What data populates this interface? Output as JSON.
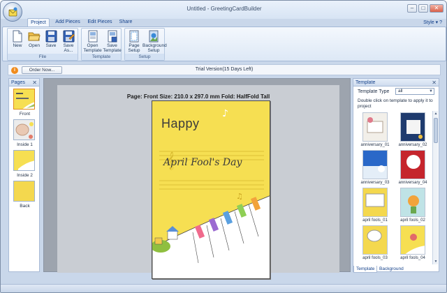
{
  "window": {
    "title": "Untitled - GreetingCardBuilder",
    "buttons": {
      "minimize": "–",
      "maximize": "□",
      "close": "✕"
    }
  },
  "tabs": [
    "Project",
    "Add Pieces",
    "Edit Pieces",
    "Share"
  ],
  "active_tab": "Project",
  "style_menu": "Style ▾ ?",
  "ribbon": {
    "groups": [
      {
        "label": "File",
        "buttons": [
          {
            "label": "New",
            "icon": "new-document-icon"
          },
          {
            "label": "Open",
            "icon": "open-folder-icon"
          },
          {
            "label": "Save",
            "icon": "save-disk-icon"
          },
          {
            "label": "Save As...",
            "icon": "save-as-disk-icon"
          }
        ]
      },
      {
        "label": "Template",
        "buttons": [
          {
            "label": "Open Template",
            "icon": "open-template-icon"
          },
          {
            "label": "Save Template",
            "icon": "save-template-icon"
          }
        ]
      },
      {
        "label": "Setup",
        "buttons": [
          {
            "label": "Page Setup",
            "icon": "page-setup-icon"
          },
          {
            "label": "Background Setup",
            "icon": "background-setup-icon"
          }
        ]
      }
    ]
  },
  "message_bar": {
    "icon": "info-icon",
    "order_button": "Order Now...",
    "trial_text": "Trial Version(15 Days Left)"
  },
  "pages_panel": {
    "title": "Pages",
    "close": "✕",
    "pages": [
      "Front",
      "Inside 1",
      "Inside 2",
      "Back"
    ]
  },
  "canvas": {
    "page_info": "Page: Front   Size: 210.0 x 297.0 mm   Fold: HalfFold Tall",
    "card": {
      "heading": "Happy",
      "subheading": "April Fool's Day"
    }
  },
  "template_panel": {
    "title": "Template",
    "close": "✕",
    "type_label": "Template Type",
    "type_value": "all",
    "hint": "Double click on template to apply it to project",
    "templates": [
      "anniversary_01",
      "anniversary_02",
      "anniversary_03",
      "anniversary_04",
      "april fools_01",
      "april fools_02",
      "april fools_03",
      "april fools_04"
    ],
    "bottom_tabs": [
      "Template",
      "Background"
    ]
  },
  "colors": {
    "ribbon": "#dde8f6",
    "card_yellow": "#f6df52",
    "accent": "#15428b",
    "info_orange": "#f08c1e"
  }
}
